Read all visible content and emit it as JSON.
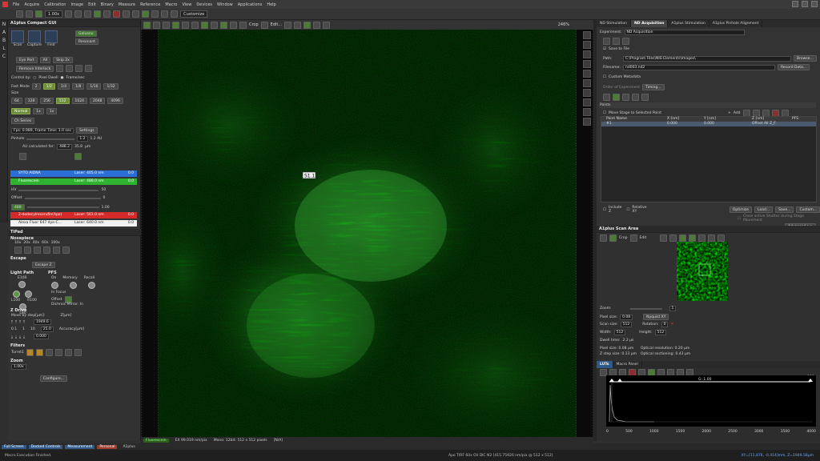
{
  "app": {
    "menu": [
      "File",
      "Acquire",
      "Calibration",
      "Image",
      "Edit",
      "Binary",
      "Measure",
      "Reference",
      "Macro",
      "View",
      "Devices",
      "Window",
      "Applications",
      "Help"
    ]
  },
  "toolbar": {
    "zoom": "1.00x",
    "customize": "Customize"
  },
  "left_panel": {
    "title": "A1plus Compact GUI",
    "scan": "Scan",
    "capture": "Capture",
    "find": "Find",
    "galvano": "Galvano",
    "resonant": "Resonant",
    "eye_port": "Eye Port",
    "all": "All",
    "skip": "Skip 2x",
    "remove_interlock": "Remove Interlock",
    "control_by": "Control by:",
    "pixel_dwell": "Pixel Dwell",
    "frame_sec": "Frame/sec",
    "fast_mode": "Fast Mode",
    "fast_values": [
      "2",
      "1/2",
      "1/4",
      "1/8",
      "1/16",
      "1/32"
    ],
    "size_label": "Size",
    "sizes": [
      "64",
      "128",
      "256",
      "512",
      "1024",
      "2048",
      "4096"
    ],
    "normal": "Normal",
    "zoom_x": "1x",
    "ch_series": "Ch Series",
    "fps_info": "Fps: 0.989, Frame Time: 1.0 sec",
    "settings": "Settings",
    "pinhole": "Pinhole",
    "pinhole_val": "1.2",
    "pinhole_unit": "1.2 AU",
    "au_calc": "AU calculated for:",
    "au_calc_val": "488.2",
    "um_val": "35.8",
    "um_unit": "µm",
    "channels": [
      {
        "name": "SYTO AIDNA",
        "laser": "Laser: 405.0 nm",
        "val": "0.0",
        "color": "#2b6fd6"
      },
      {
        "name": "Fluorescein",
        "laser": "Laser: 488.0 nm",
        "val": "0.0",
        "color": "#2fb22f"
      },
      {
        "name": "2-dodecylresorufin(Apo)",
        "laser": "Laser: 561.0 nm",
        "val": "0.0",
        "color": "#d42a2a"
      },
      {
        "name": "Alexa Fluor 647 dye-C...",
        "laser": "Laser: 640.0 nm",
        "val": "0.0",
        "color": "#ffffff"
      }
    ],
    "hv_label": "HV",
    "hv_val": "50",
    "offset_label": "Offset",
    "offset_val": "0",
    "laser_val": "1.00",
    "laser_pct": "488",
    "tipad": "TiPad",
    "nosepiece": "Nosepiece",
    "objectives": [
      "10x",
      "20x",
      "40x",
      "60x",
      "100x"
    ],
    "escape": "Escape",
    "escape_z": "Escape Z",
    "light_path": "Light Path",
    "pfs": "PFS",
    "lp_e100": "E100",
    "lp_l100": "L100",
    "lp_r100": "R100",
    "lp_l80": "L80",
    "pfs_on": "On",
    "pfs_memory": "Memory",
    "pfs_recall": "Recall",
    "pfs_infocus": "In Focus",
    "pfs_offset": "Offset",
    "dichroic": "Dichroic Mirror: In",
    "zdrive": "Z Drive",
    "move_by_step": "Move by step[µm]:",
    "z_um": "Z[µm]",
    "z_val": "1949.6",
    "steps": [
      "0.1",
      "1",
      "10",
      "25.0"
    ],
    "accuracy": "Accuracy[µm]",
    "accuracy_val": "0.000",
    "filters": "Filters",
    "turret": "Turret1",
    "zoom_label": "Zoom",
    "zoom_val": "1.00x",
    "configure": "Configure..."
  },
  "viewer": {
    "crop": "Crop",
    "edit": "Edit...",
    "zoom_pct": "246%",
    "roi_label": "S1.1",
    "status_tab": "Fluorescein",
    "status_wl": "EX 99.019 nm/pix",
    "status_mono": "Mono: 12bit: 512 x 512 pixels",
    "status_end": "[N/A]"
  },
  "right_panel": {
    "tabs": [
      "ND Stimulation",
      "ND Acquisition",
      "A1plus Stimulation",
      "A1plus Pinhole Alignment"
    ],
    "experiment_label": "Experiment:",
    "experiment": "ND Acquisition",
    "save_to_file": "Save to File",
    "path_label": "Path:",
    "path": "C:\\Program Files\\NIS-Elements\\Images\\",
    "browse": "Browse...",
    "filename_label": "Filename:",
    "filename": "nd003.nd2",
    "record_data": "Record Data...",
    "custom_metadata": "Custom Metadata",
    "order": "Order of Experiment",
    "timing": "Timing...",
    "points_label": "Points",
    "move_stage": "Move Stage to Selected Point",
    "add": "Add",
    "columns": [
      "Point Name",
      "X [nm]",
      "Y [nm]",
      "Z [nm]",
      "PFS"
    ],
    "point_row": {
      "name": "#1",
      "x": "0.000",
      "y": "0.000",
      "z": "Offset All Z_F",
      "pfs": ""
    },
    "include_z": "Include Z",
    "relative_xy": "Relative XY",
    "optimize": "Optimize",
    "load": "Load...",
    "save": "Save...",
    "custom": "Custom...",
    "close_shutter": "Close active Shutter during Stage Movement",
    "advanced": "Advanced >>",
    "load_btn": "Load",
    "save_btn": "Save",
    "remove": "Remove",
    "run_z": "Run Z Corr",
    "one_step": "1 time step",
    "run_now": "Run now"
  },
  "scan_area": {
    "title": "A1plus Scan Area",
    "crop": "Crop",
    "edit": "Edit",
    "zoom_label": "Zoom:",
    "zoom_val": "1",
    "pixel_size_label": "Pixel size:",
    "pixel_size": "0.08",
    "nyquist": "Nyquist XY",
    "scan_size_label": "Scan size:",
    "scan_size": "512",
    "rotation_label": "Rotation:",
    "rotation": "0",
    "width_label": "Width:",
    "width": "512",
    "height_label": "Height:",
    "height": "512",
    "dwell_label": "Dwell time:",
    "dwell": "2.2 µs",
    "pixel_size2": "Pixel size: 0.08 µm",
    "opt_res": "Optical resolution: 0.20 µm",
    "z_step": "Z step size: 0.13 µm",
    "opt_sect": "Optical sectioning: 0.43 µm"
  },
  "lut": {
    "tabs": [
      "LUTs",
      "Macro Panel"
    ],
    "gamma": "G: 1.00",
    "max_label": "180",
    "ticks": [
      "0",
      "500",
      "1000",
      "1500",
      "2000",
      "2500",
      "3000",
      "3500",
      "4000"
    ]
  },
  "bottom": {
    "tabs": [
      "Full Screen",
      "Docked Controls",
      "Measurement",
      "Personal"
    ],
    "a1plus": "A1plus"
  },
  "statusbar": {
    "left": "Macro Execution Finished.",
    "mid": "Apo TIRF 60x Oil DIC N2 [415.75920 nm/pix @ 512 x 512]",
    "coord": "XY=[11,876, -0.414]mm, Z=1949.58µm"
  },
  "colors": {
    "green": "#2fd42f",
    "accent": "#6d8d3a",
    "blue": "#2b6fd6"
  }
}
